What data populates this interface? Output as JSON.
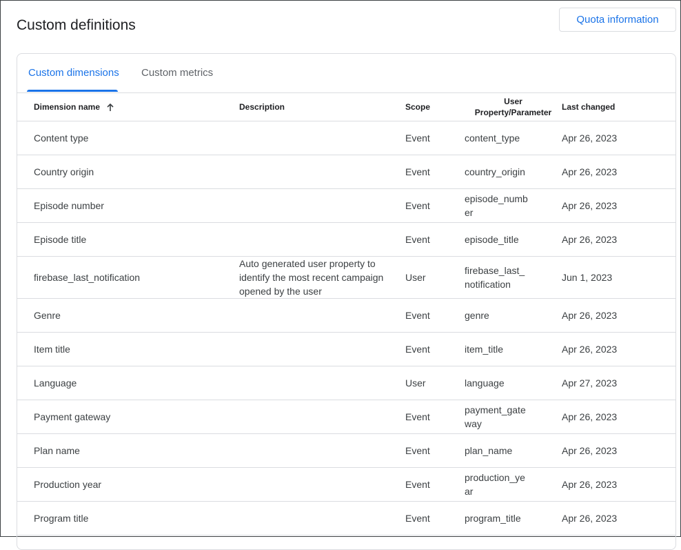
{
  "header": {
    "title": "Custom definitions",
    "quota_button": "Quota information"
  },
  "tabs": [
    {
      "label": "Custom dimensions",
      "active": true
    },
    {
      "label": "Custom metrics",
      "active": false
    }
  ],
  "table": {
    "columns": [
      "Dimension name",
      "Description",
      "Scope",
      "User Property/Parameter",
      "Last changed"
    ],
    "user_property_header_line1": "User",
    "user_property_header_line2": "Property/Parameter",
    "sort_icon": "arrow-up-icon",
    "rows": [
      {
        "name": "Content type",
        "description": "",
        "scope": "Event",
        "parameter": "content_type",
        "last_changed": "Apr 26, 2023"
      },
      {
        "name": "Country origin",
        "description": "",
        "scope": "Event",
        "parameter": "country_origin",
        "last_changed": "Apr 26, 2023"
      },
      {
        "name": "Episode number",
        "description": "",
        "scope": "Event",
        "parameter": "episode_number",
        "last_changed": "Apr 26, 2023"
      },
      {
        "name": "Episode title",
        "description": "",
        "scope": "Event",
        "parameter": "episode_title",
        "last_changed": "Apr 26, 2023"
      },
      {
        "name": "firebase_last_notification",
        "description": "Auto generated user property to identify the most recent campaign opened by the user",
        "scope": "User",
        "parameter": "firebase_last_notification",
        "last_changed": "Jun 1, 2023"
      },
      {
        "name": "Genre",
        "description": "",
        "scope": "Event",
        "parameter": "genre",
        "last_changed": "Apr 26, 2023"
      },
      {
        "name": "Item title",
        "description": "",
        "scope": "Event",
        "parameter": "item_title",
        "last_changed": "Apr 26, 2023"
      },
      {
        "name": "Language",
        "description": "",
        "scope": "User",
        "parameter": "language",
        "last_changed": "Apr 27, 2023"
      },
      {
        "name": "Payment gateway",
        "description": "",
        "scope": "Event",
        "parameter": "payment_gateway",
        "last_changed": "Apr 26, 2023"
      },
      {
        "name": "Plan name",
        "description": "",
        "scope": "Event",
        "parameter": "plan_name",
        "last_changed": "Apr 26, 2023"
      },
      {
        "name": "Production year",
        "description": "",
        "scope": "Event",
        "parameter": "production_year",
        "last_changed": "Apr 26, 2023"
      },
      {
        "name": "Program title",
        "description": "",
        "scope": "Event",
        "parameter": "program_title",
        "last_changed": "Apr 26, 2023"
      }
    ]
  },
  "colors": {
    "accent": "#1a73e8",
    "border": "#dadce0",
    "text": "#3c4043"
  }
}
